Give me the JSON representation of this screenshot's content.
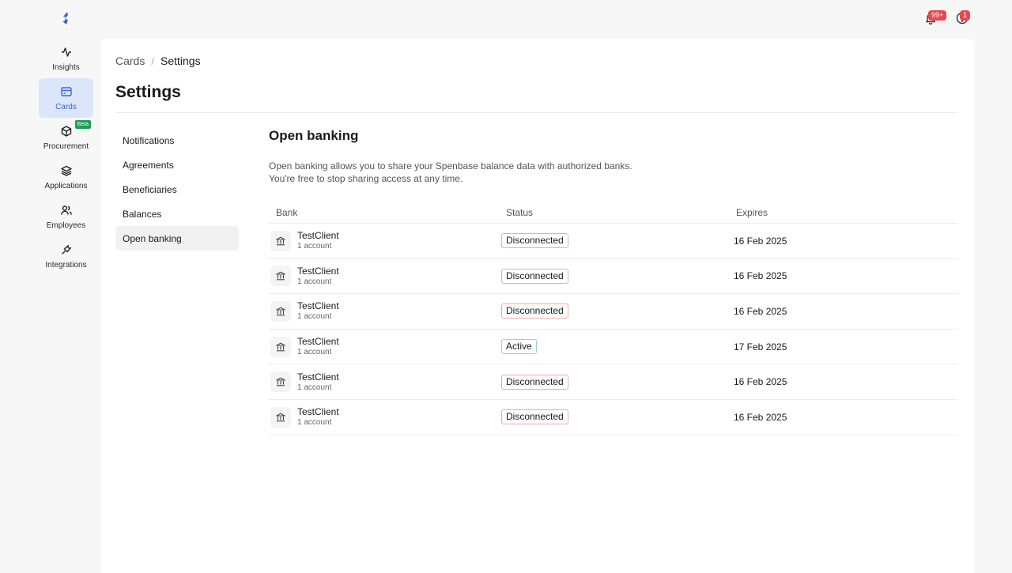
{
  "topbar": {
    "notifications_badge": "99+",
    "help_badge": "1",
    "accent": "#3d63d3"
  },
  "sidebar": {
    "items": [
      {
        "label": "Insights",
        "icon": "activity-icon"
      },
      {
        "label": "Cards",
        "icon": "credit-card-icon",
        "active": true
      },
      {
        "label": "Procurement",
        "icon": "box-icon",
        "badge": "Beta"
      },
      {
        "label": "Applications",
        "icon": "layers-icon"
      },
      {
        "label": "Employees",
        "icon": "users-icon"
      },
      {
        "label": "Integrations",
        "icon": "plug-icon"
      }
    ]
  },
  "breadcrumb": {
    "parent": "Cards",
    "separator": "/",
    "current": "Settings"
  },
  "page": {
    "title": "Settings"
  },
  "settings_menu": {
    "items": [
      "Notifications",
      "Agreements",
      "Beneficiaries",
      "Balances",
      "Open banking"
    ],
    "active": "Open banking"
  },
  "open_banking": {
    "title": "Open banking",
    "description_line1": "Open banking allows you to share your Spenbase balance data with authorized banks.",
    "description_line2": "You're free to stop sharing access at any time.",
    "columns": {
      "bank": "Bank",
      "status": "Status",
      "expires": "Expires"
    },
    "rows": [
      {
        "bank": "TestClient",
        "accounts": "1 account",
        "status": "Disconnected",
        "expires": "16 Feb 2025"
      },
      {
        "bank": "TestClient",
        "accounts": "1 account",
        "status": "Disconnected",
        "expires": "16 Feb 2025"
      },
      {
        "bank": "TestClient",
        "accounts": "1 account",
        "status": "Disconnected",
        "expires": "16 Feb 2025"
      },
      {
        "bank": "TestClient",
        "accounts": "1 account",
        "status": "Active",
        "expires": "17 Feb 2025"
      },
      {
        "bank": "TestClient",
        "accounts": "1 account",
        "status": "Disconnected",
        "expires": "16 Feb 2025"
      },
      {
        "bank": "TestClient",
        "accounts": "1 account",
        "status": "Disconnected",
        "expires": "16 Feb 2025"
      }
    ]
  }
}
